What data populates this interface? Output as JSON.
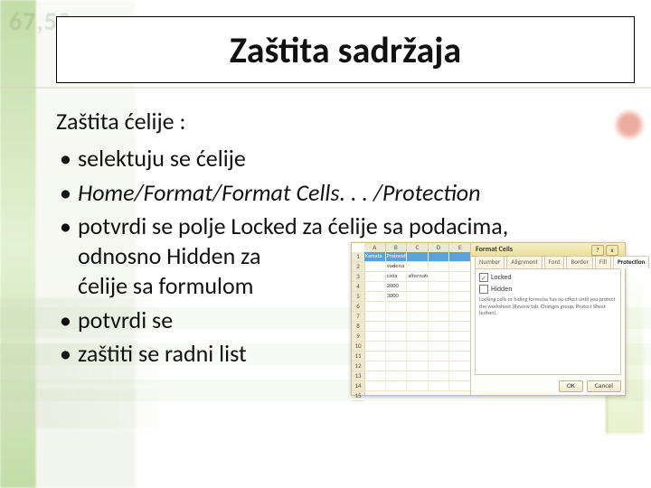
{
  "title": "Zaštita sadržaja",
  "lead": "Zaštita ćelije :",
  "bullets": {
    "b1": "selektuju se ćelije",
    "b2": "Home/Format/Format Cells. . . /Protection",
    "b3a": "potvrdi se polje Locked za ćelije sa podacima,",
    "b3b": "odnosno Hidden za",
    "b3c": "ćelije sa formulom",
    "b4": "potvrdi se",
    "b5": "zaštiti se radni list"
  },
  "screenshot": {
    "cols": {
      "A": "A",
      "B": "B",
      "C": "C",
      "D": "D",
      "E": "E"
    },
    "rownums": [
      "1",
      "2",
      "3",
      "4",
      "5",
      "6",
      "7",
      "8",
      "9",
      "10",
      "11",
      "12",
      "13",
      "14",
      "15"
    ],
    "header_row": {
      "a": "Kamata",
      "b": "Proizvodnja",
      "c": "",
      "d": "",
      "e": ""
    },
    "rows": [
      {
        "a": "",
        "b": "vodena pumpa",
        "c": "",
        "d": "",
        "e": ""
      },
      {
        "a": "",
        "b": "cista",
        "c": "alternator",
        "d": "",
        "e": ""
      },
      {
        "a": "",
        "b": "2000",
        "c": "",
        "d": "",
        "e": ""
      },
      {
        "a": "",
        "b": "3000",
        "c": "",
        "d": "",
        "e": ""
      }
    ],
    "dialog": {
      "title": "Format Cells",
      "tabs": [
        "Number",
        "Alignment",
        "Font",
        "Border",
        "Fill",
        "Protection"
      ],
      "active_tab": "Protection",
      "locked_label": "Locked",
      "hidden_label": "Hidden",
      "locked_checked": "✓",
      "hint": "Locking cells or hiding formulas has no effect until you protect the worksheet (Review tab, Changes group, Protect Sheet button).",
      "ok": "OK",
      "cancel": "Cancel",
      "help": "?",
      "close": "x"
    }
  }
}
